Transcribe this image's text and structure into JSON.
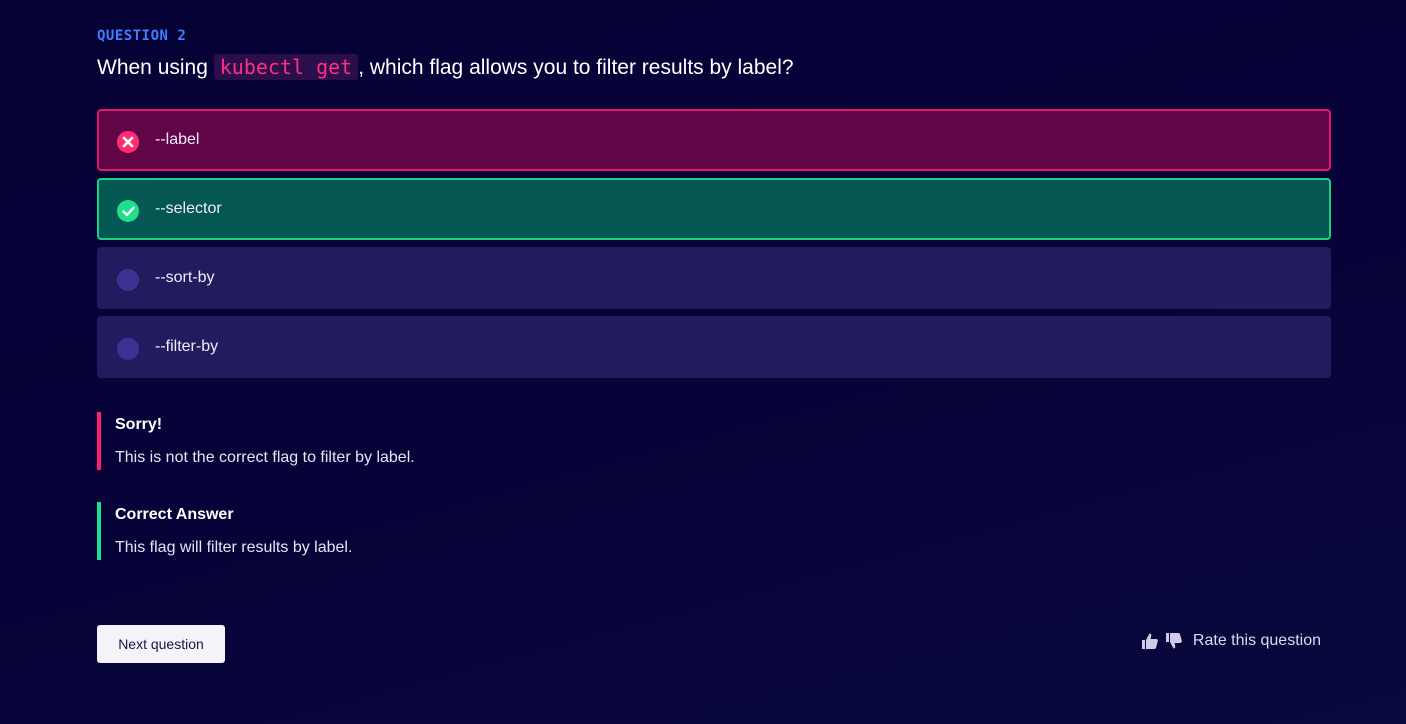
{
  "question": {
    "label": "QUESTION 2",
    "text_before": "When using ",
    "code": "kubectl get",
    "text_after": ", which flag allows you to filter results by label?"
  },
  "options": [
    {
      "label": "--label",
      "state": "wrong",
      "icon": "x-circle-icon"
    },
    {
      "label": "--selector",
      "state": "correct",
      "icon": "check-circle-icon"
    },
    {
      "label": "--sort-by",
      "state": "unselected",
      "icon": "radio-empty-icon"
    },
    {
      "label": "--filter-by",
      "state": "unselected",
      "icon": "radio-empty-icon"
    }
  ],
  "feedback": {
    "sorry": {
      "title": "Sorry!",
      "body": "This is not the correct flag to filter by label."
    },
    "correct": {
      "title": "Correct Answer",
      "body": "This flag will filter results by label."
    }
  },
  "footer": {
    "next_label": "Next question",
    "rate_label": "Rate this question",
    "thumbs_up_icon": "thumbs-up-icon",
    "thumbs_down_icon": "thumbs-down-icon"
  },
  "colors": {
    "background": "#070236",
    "accent_blue": "#3d7fff",
    "wrong": "#e0156b",
    "correct": "#1cd07e",
    "option_neutral": "#221c5e"
  }
}
